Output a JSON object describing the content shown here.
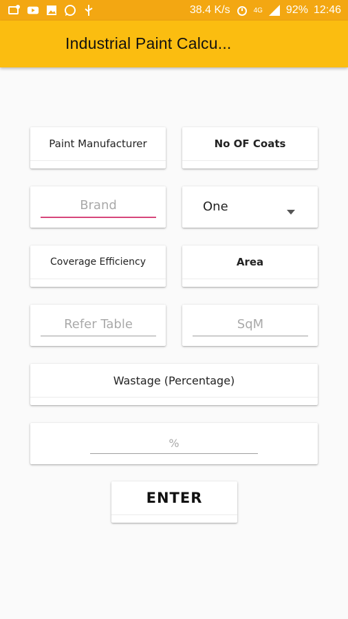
{
  "status_bar": {
    "speed": "38.4 K/s",
    "network": "4G",
    "battery": "92%",
    "time": "12:46",
    "icons": [
      "mail-alert-icon",
      "youtube-icon",
      "gallery-icon",
      "whatsapp-icon",
      "usb-icon",
      "alarm-icon",
      "signal-icon",
      "battery-icon"
    ]
  },
  "app_bar": {
    "title": "Industrial Paint Calcu..."
  },
  "form": {
    "paint_manufacturer_label": "Paint Manufacturer",
    "no_of_coats_label": "No OF Coats",
    "brand_placeholder": "Brand",
    "coats_value": "One",
    "coverage_label": "Coverage Efficiency",
    "area_label": "Area",
    "coverage_placeholder": "Refer Table",
    "area_placeholder": "SqM",
    "wastage_label": "Wastage (Percentage)",
    "wastage_placeholder": "%",
    "enter_button": "ENTER"
  },
  "colors": {
    "status_bar": "#f3a712",
    "app_bar": "#fbbd10",
    "focus_accent": "#d6457a"
  }
}
